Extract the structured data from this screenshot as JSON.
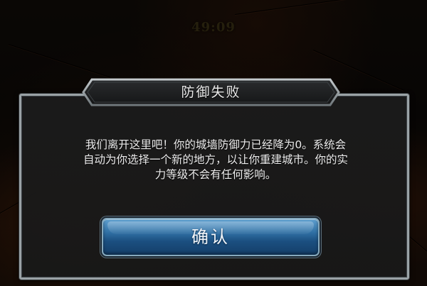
{
  "timer": {
    "value": "49:09"
  },
  "dialog": {
    "title": "防御失败",
    "message_lines": [
      "我们离开这里吧！你的城墙防御力已经降为0。系统会",
      "自动为你选择一个新的地方，以让你重建城市。你的实",
      "力等级不会有任何影响。"
    ],
    "confirm_label": "确认"
  },
  "colors": {
    "button_blue": "#2f6fa3",
    "frame_silver": "#9aa2a6",
    "dialog_background": "#1c1c1c",
    "timer_text": "#3a3114"
  }
}
